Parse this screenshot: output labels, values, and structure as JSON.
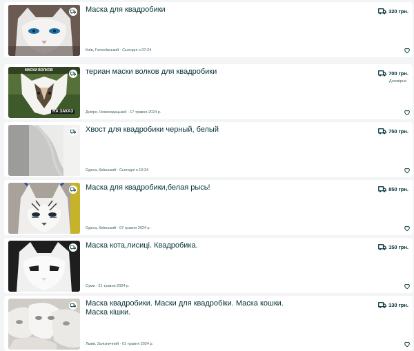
{
  "listings": [
    {
      "title": "Маска для квадробики",
      "location_date": "Київ, Голосіївський - Сьогодні о 07:24",
      "price": "320 грн.",
      "negotiable": "",
      "image": "white-cat-mask-blue-eyes"
    },
    {
      "title": "териан маски волков для квадробики",
      "location_date": "Дніпро, Новокодацький - 17 травня 2024 р.",
      "price": "700 грн.",
      "negotiable": "Договірна",
      "image": "wolf-mask-green-background",
      "image_caption_top": "МАСКИ ВОЛКОВ",
      "image_caption_bottom": "НА ЗАКАЗ"
    },
    {
      "title": "Хвост для квадробики черный, белый",
      "location_date": "Одеса, Київський - Сьогодні о 10:34",
      "price": "750 грн.",
      "negotiable": "",
      "image": "white-fur-tail"
    },
    {
      "title": "Маска для квадробики,белая рысь!",
      "location_date": "Одеса, Київський - 07 травня 2024 р.",
      "price": "850 грн.",
      "negotiable": "",
      "image": "white-lynx-mask"
    },
    {
      "title": "Маска кота,лисиці. Квадробика.",
      "location_date": "Суми - 21 травня 2024 р.",
      "price": "150 грн.",
      "negotiable": "",
      "image": "white-plain-cat-mask"
    },
    {
      "title": "Маска квадробики. Маски для квадробіки. Маска кошки. Маска кішки.",
      "location_date": "Львів, Залізничний - 01 травня 2024 р.",
      "price": "130 грн.",
      "negotiable": "",
      "image": "stack-of-white-masks"
    }
  ],
  "icons": {
    "delivery_badge": "delivery-truck-icon",
    "delivery_price": "delivery-truck-icon",
    "favorite": "heart-icon"
  },
  "colors": {
    "background": "#f2f4f5",
    "card": "#ffffff",
    "text": "#002f34",
    "muted": "#406367"
  }
}
